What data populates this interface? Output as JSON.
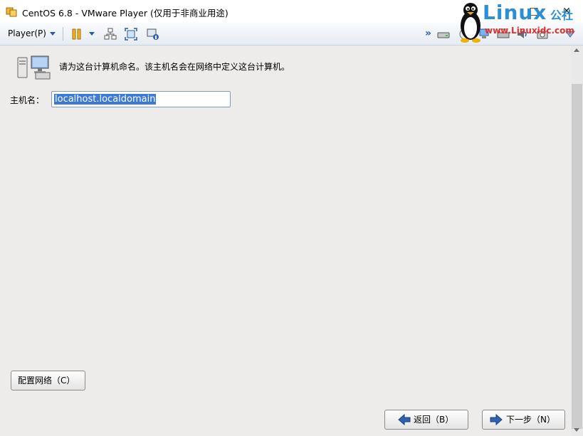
{
  "window": {
    "title": "CentOS 6.8 - VMware Player (仅用于非商业用途)",
    "minimize": "–",
    "maximize": "□",
    "close": "✕"
  },
  "watermark": {
    "brand": "Linux",
    "brand_cn": "公社",
    "url": "www.Linuxidc.com"
  },
  "toolbar": {
    "player_menu": "Player(P)",
    "more": "»"
  },
  "dialog": {
    "prompt": "请为这台计算机命名。该主机名会在网络中定义这台计算机。",
    "hostname_label": "主机名：",
    "hostname_value": "localhost.localdomain",
    "configure_network": "配置网络（C）",
    "back": "返回（B）",
    "next": "下一步（N）"
  },
  "colors": {
    "selection": "#3d7ad6",
    "nav_arrow": "#2f62b2",
    "brand_blue": "#2b8fd6",
    "brand_red": "#e0302c"
  }
}
